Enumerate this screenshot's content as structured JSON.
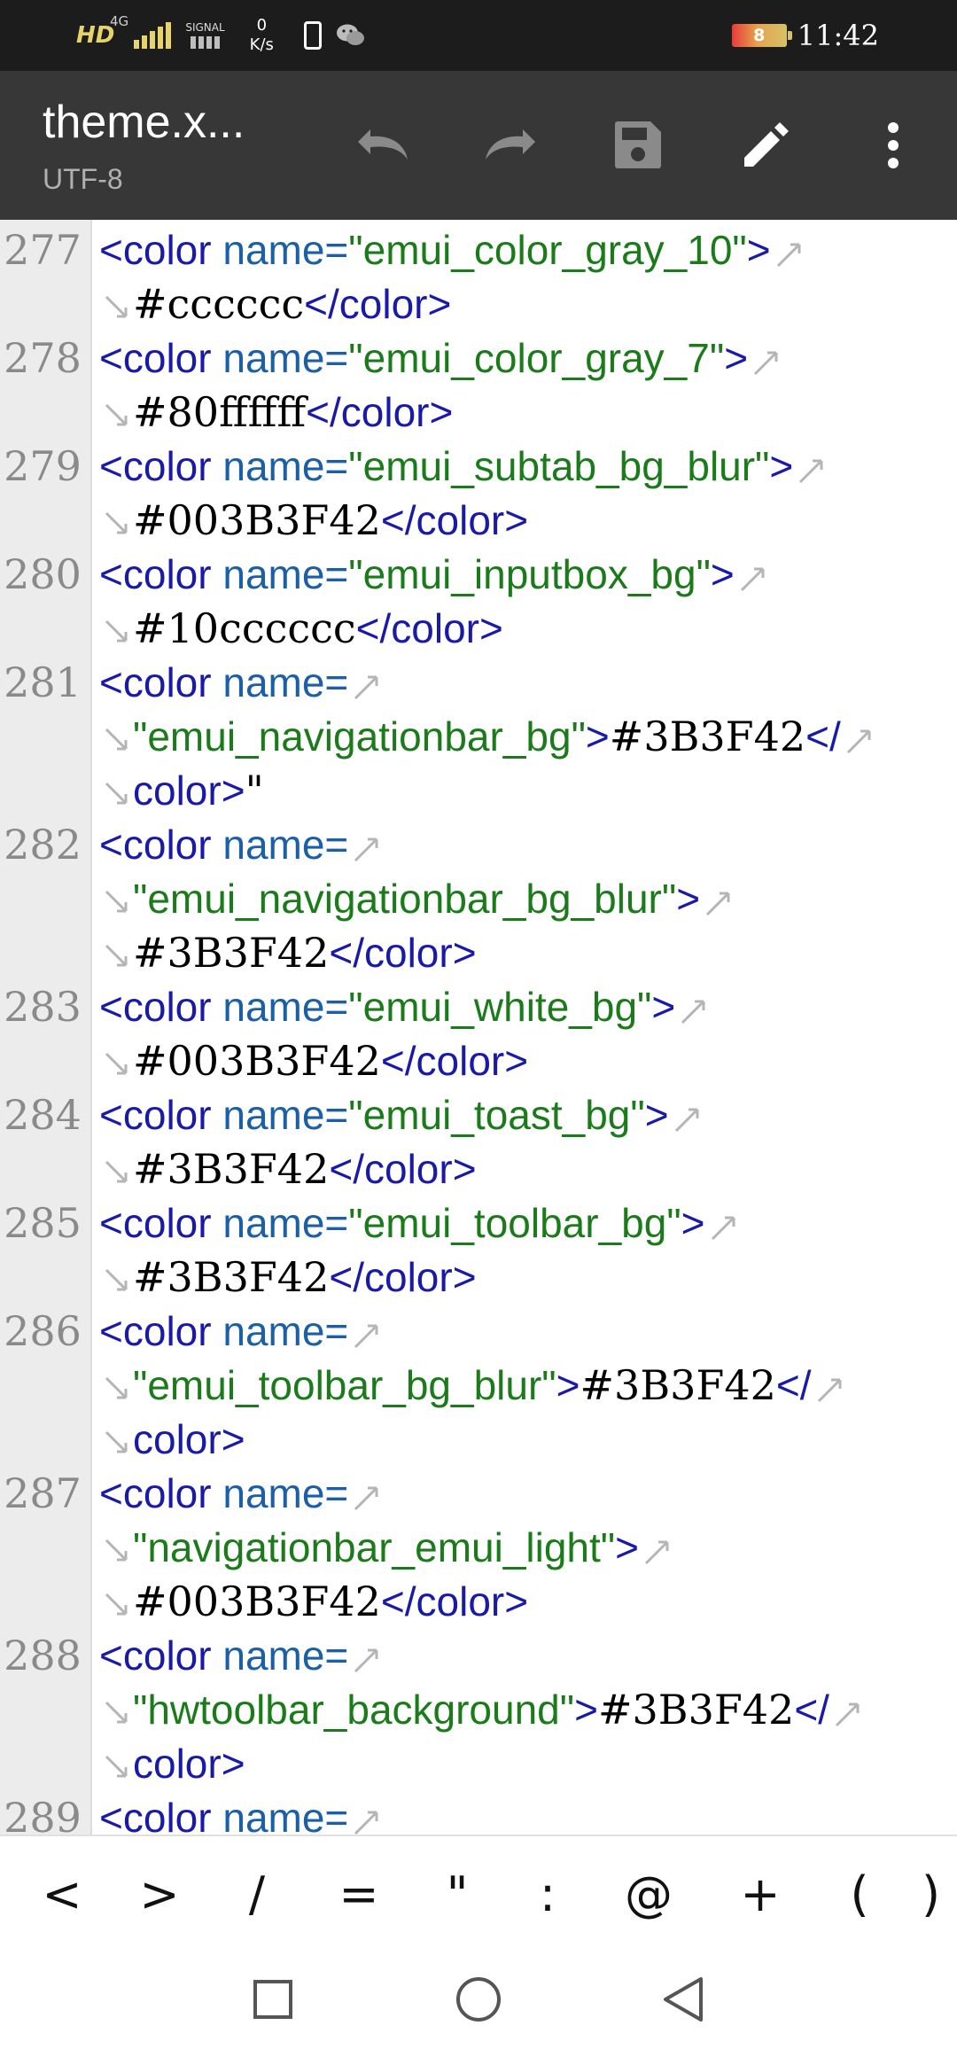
{
  "status_bar": {
    "network_hd": "HD",
    "network_4g": "4G",
    "signal_label": "SIGNAL",
    "speed_value": "0",
    "speed_unit": "K/s",
    "battery_level": "8",
    "time": "11:42"
  },
  "toolbar": {
    "title": "theme.x...",
    "encoding": "UTF-8",
    "icons": [
      "undo-icon",
      "redo-icon",
      "save-icon",
      "edit-icon",
      "more-vert-icon"
    ]
  },
  "editor": {
    "lines": [
      {
        "num": "277",
        "rows": [
          [
            {
              "t": "tag",
              "v": "<color"
            },
            {
              "t": "sp",
              "v": " "
            },
            {
              "t": "attr",
              "v": "name="
            },
            {
              "t": "str",
              "v": "\"emui_color_gray_10\""
            },
            {
              "t": "tag",
              "v": ">"
            },
            {
              "t": "we"
            }
          ],
          [
            {
              "t": "ws"
            },
            {
              "t": "val",
              "v": "#cccccc"
            },
            {
              "t": "tag",
              "v": "</color>"
            }
          ]
        ]
      },
      {
        "num": "278",
        "rows": [
          [
            {
              "t": "tag",
              "v": "<color"
            },
            {
              "t": "sp",
              "v": " "
            },
            {
              "t": "attr",
              "v": "name="
            },
            {
              "t": "str",
              "v": "\"emui_color_gray_7\""
            },
            {
              "t": "tag",
              "v": ">"
            },
            {
              "t": "we"
            }
          ],
          [
            {
              "t": "ws"
            },
            {
              "t": "val",
              "v": "#80ffffff"
            },
            {
              "t": "tag",
              "v": "</color>"
            }
          ]
        ]
      },
      {
        "num": "279",
        "rows": [
          [
            {
              "t": "tag",
              "v": "<color"
            },
            {
              "t": "sp",
              "v": " "
            },
            {
              "t": "attr",
              "v": "name="
            },
            {
              "t": "str",
              "v": "\"emui_subtab_bg_blur\""
            },
            {
              "t": "tag",
              "v": ">"
            },
            {
              "t": "we"
            }
          ],
          [
            {
              "t": "ws"
            },
            {
              "t": "val",
              "v": "#003B3F42"
            },
            {
              "t": "tag",
              "v": "</color>"
            }
          ]
        ]
      },
      {
        "num": "280",
        "rows": [
          [
            {
              "t": "tag",
              "v": "<color"
            },
            {
              "t": "sp",
              "v": " "
            },
            {
              "t": "attr",
              "v": "name="
            },
            {
              "t": "str",
              "v": "\"emui_inputbox_bg\""
            },
            {
              "t": "tag",
              "v": ">"
            },
            {
              "t": "we"
            }
          ],
          [
            {
              "t": "ws"
            },
            {
              "t": "val",
              "v": "#10cccccc"
            },
            {
              "t": "tag",
              "v": "</color>"
            }
          ]
        ]
      },
      {
        "num": "281",
        "rows": [
          [
            {
              "t": "tag",
              "v": "<color"
            },
            {
              "t": "sp",
              "v": " "
            },
            {
              "t": "attr",
              "v": "name="
            },
            {
              "t": "we"
            }
          ],
          [
            {
              "t": "ws"
            },
            {
              "t": "str",
              "v": "\"emui_navigationbar_bg\""
            },
            {
              "t": "tag",
              "v": ">"
            },
            {
              "t": "val",
              "v": "#3B3F42"
            },
            {
              "t": "tag",
              "v": "</"
            },
            {
              "t": "we"
            }
          ],
          [
            {
              "t": "ws"
            },
            {
              "t": "tag",
              "v": "color>"
            },
            {
              "t": "val",
              "v": "\""
            }
          ]
        ]
      },
      {
        "num": "282",
        "rows": [
          [
            {
              "t": "tag",
              "v": "<color"
            },
            {
              "t": "sp",
              "v": " "
            },
            {
              "t": "attr",
              "v": "name="
            },
            {
              "t": "we"
            }
          ],
          [
            {
              "t": "ws"
            },
            {
              "t": "str",
              "v": "\"emui_navigationbar_bg_blur\""
            },
            {
              "t": "tag",
              "v": ">"
            },
            {
              "t": "we"
            }
          ],
          [
            {
              "t": "ws"
            },
            {
              "t": "val",
              "v": "#3B3F42"
            },
            {
              "t": "tag",
              "v": "</color>"
            }
          ]
        ]
      },
      {
        "num": "283",
        "rows": [
          [
            {
              "t": "tag",
              "v": "<color"
            },
            {
              "t": "sp",
              "v": " "
            },
            {
              "t": "attr",
              "v": "name="
            },
            {
              "t": "str",
              "v": "\"emui_white_bg\""
            },
            {
              "t": "tag",
              "v": ">"
            },
            {
              "t": "we"
            }
          ],
          [
            {
              "t": "ws"
            },
            {
              "t": "val",
              "v": "#003B3F42"
            },
            {
              "t": "tag",
              "v": "</color>"
            }
          ]
        ]
      },
      {
        "num": "284",
        "rows": [
          [
            {
              "t": "tag",
              "v": "<color"
            },
            {
              "t": "sp",
              "v": " "
            },
            {
              "t": "attr",
              "v": "name="
            },
            {
              "t": "str",
              "v": "\"emui_toast_bg\""
            },
            {
              "t": "tag",
              "v": ">"
            },
            {
              "t": "we"
            }
          ],
          [
            {
              "t": "ws"
            },
            {
              "t": "val",
              "v": "#3B3F42"
            },
            {
              "t": "tag",
              "v": "</color>"
            }
          ]
        ]
      },
      {
        "num": "285",
        "rows": [
          [
            {
              "t": "tag",
              "v": "<color"
            },
            {
              "t": "sp",
              "v": " "
            },
            {
              "t": "attr",
              "v": "name="
            },
            {
              "t": "str",
              "v": "\"emui_toolbar_bg\""
            },
            {
              "t": "tag",
              "v": ">"
            },
            {
              "t": "we"
            }
          ],
          [
            {
              "t": "ws"
            },
            {
              "t": "val",
              "v": "#3B3F42"
            },
            {
              "t": "tag",
              "v": "</color>"
            }
          ]
        ]
      },
      {
        "num": "286",
        "rows": [
          [
            {
              "t": "tag",
              "v": "<color"
            },
            {
              "t": "sp",
              "v": " "
            },
            {
              "t": "attr",
              "v": "name="
            },
            {
              "t": "we"
            }
          ],
          [
            {
              "t": "ws"
            },
            {
              "t": "str",
              "v": "\"emui_toolbar_bg_blur\""
            },
            {
              "t": "tag",
              "v": ">"
            },
            {
              "t": "val",
              "v": "#3B3F42"
            },
            {
              "t": "tag",
              "v": "</"
            },
            {
              "t": "we"
            }
          ],
          [
            {
              "t": "ws"
            },
            {
              "t": "tag",
              "v": "color>"
            }
          ]
        ]
      },
      {
        "num": "287",
        "rows": [
          [
            {
              "t": "tag",
              "v": "<color"
            },
            {
              "t": "sp",
              "v": " "
            },
            {
              "t": "attr",
              "v": "name="
            },
            {
              "t": "we"
            }
          ],
          [
            {
              "t": "ws"
            },
            {
              "t": "str",
              "v": "\"navigationbar_emui_light\""
            },
            {
              "t": "tag",
              "v": ">"
            },
            {
              "t": "we"
            }
          ],
          [
            {
              "t": "ws"
            },
            {
              "t": "val",
              "v": "#003B3F42"
            },
            {
              "t": "tag",
              "v": "</color>"
            }
          ]
        ]
      },
      {
        "num": "288",
        "rows": [
          [
            {
              "t": "tag",
              "v": "<color"
            },
            {
              "t": "sp",
              "v": " "
            },
            {
              "t": "attr",
              "v": "name="
            },
            {
              "t": "we"
            }
          ],
          [
            {
              "t": "ws"
            },
            {
              "t": "str",
              "v": "\"hwtoolbar_background\""
            },
            {
              "t": "tag",
              "v": ">"
            },
            {
              "t": "val",
              "v": "#3B3F42"
            },
            {
              "t": "tag",
              "v": "</"
            },
            {
              "t": "we"
            }
          ],
          [
            {
              "t": "ws"
            },
            {
              "t": "tag",
              "v": "color>"
            }
          ]
        ]
      },
      {
        "num": "289",
        "rows": [
          [
            {
              "t": "tag",
              "v": "<color"
            },
            {
              "t": "sp",
              "v": " "
            },
            {
              "t": "attr",
              "v": "name="
            },
            {
              "t": "we"
            }
          ]
        ]
      }
    ]
  },
  "symbols": [
    "<",
    ">",
    "/",
    "=",
    "\"",
    ":",
    "@",
    "+",
    "("
  ],
  "nav_bar": [
    "recents-square-icon",
    "home-circle-icon",
    "back-triangle-icon"
  ]
}
